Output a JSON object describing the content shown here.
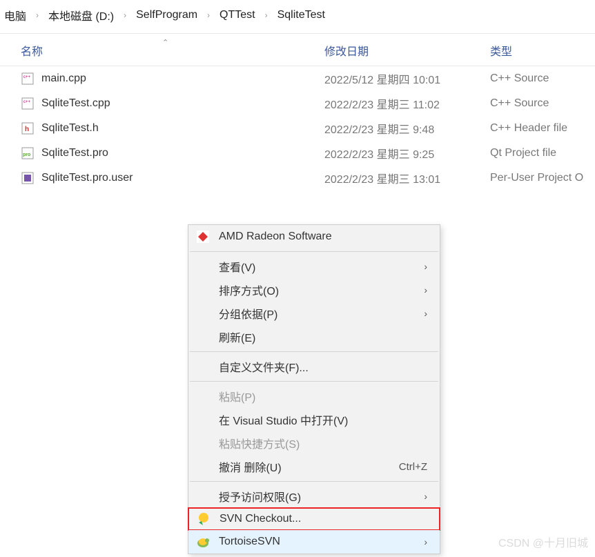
{
  "breadcrumb": {
    "items": [
      "电脑",
      "本地磁盘 (D:)",
      "SelfProgram",
      "QTTest",
      "SqliteTest"
    ]
  },
  "headers": {
    "name": "名称",
    "date": "修改日期",
    "type": "类型"
  },
  "files": [
    {
      "icon": "cpp",
      "name": "main.cpp",
      "date": "2022/5/12 星期四 10:01",
      "type": "C++ Source"
    },
    {
      "icon": "cpp",
      "name": "SqliteTest.cpp",
      "date": "2022/2/23 星期三 11:02",
      "type": "C++ Source"
    },
    {
      "icon": "h",
      "name": "SqliteTest.h",
      "date": "2022/2/23 星期三 9:48",
      "type": "C++ Header file"
    },
    {
      "icon": "pro",
      "name": "SqliteTest.pro",
      "date": "2022/2/23 星期三 9:25",
      "type": "Qt Project file"
    },
    {
      "icon": "user",
      "name": "SqliteTest.pro.user",
      "date": "2022/2/23 星期三 13:01",
      "type": "Per-User Project O"
    }
  ],
  "menu": {
    "items": [
      {
        "icon": "amd",
        "label": "AMD Radeon Software",
        "type": "item"
      },
      {
        "type": "sep"
      },
      {
        "label": "查看(V)",
        "type": "submenu"
      },
      {
        "label": "排序方式(O)",
        "type": "submenu"
      },
      {
        "label": "分组依据(P)",
        "type": "submenu"
      },
      {
        "label": "刷新(E)",
        "type": "item"
      },
      {
        "type": "sep"
      },
      {
        "label": "自定义文件夹(F)...",
        "type": "item"
      },
      {
        "type": "sep"
      },
      {
        "label": "粘贴(P)",
        "type": "item",
        "disabled": true
      },
      {
        "label": "在 Visual Studio 中打开(V)",
        "type": "item"
      },
      {
        "label": "粘贴快捷方式(S)",
        "type": "item",
        "disabled": true
      },
      {
        "label": "撤消 删除(U)",
        "type": "item",
        "shortcut": "Ctrl+Z"
      },
      {
        "type": "sep"
      },
      {
        "label": "授予访问权限(G)",
        "type": "submenu"
      },
      {
        "icon": "svn-checkout",
        "label": "SVN Checkout...",
        "type": "item",
        "redbox": true
      },
      {
        "icon": "tortoise",
        "label": "TortoiseSVN",
        "type": "submenu",
        "highlighted": true
      }
    ]
  },
  "watermark": "CSDN @十月旧城"
}
